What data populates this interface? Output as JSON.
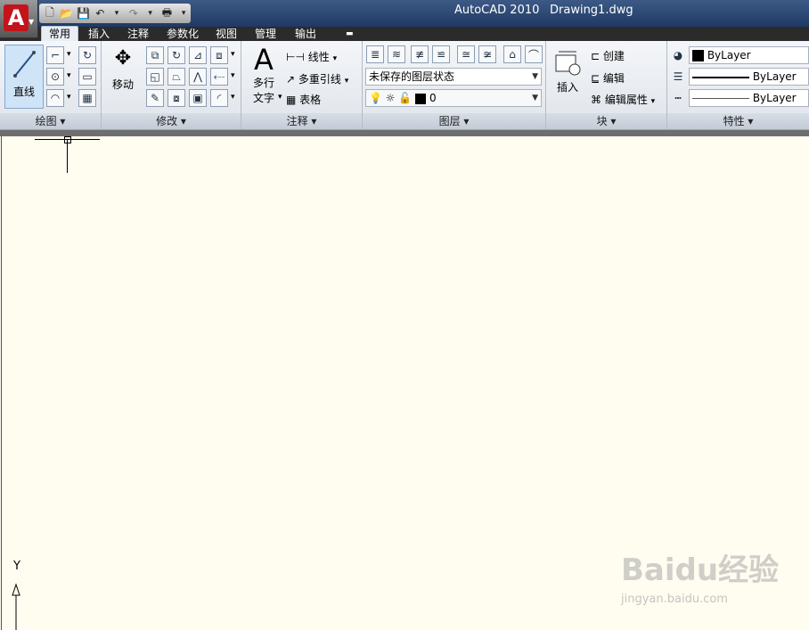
{
  "title": {
    "app": "AutoCAD 2010",
    "file": "Drawing1.dwg"
  },
  "app_button": {
    "letter": "A"
  },
  "qat": {
    "icons": [
      "new-icon",
      "open-icon",
      "save-icon",
      "undo-icon",
      "redo-icon",
      "plot-icon",
      "customize-icon"
    ]
  },
  "tabs": [
    "常用",
    "插入",
    "注释",
    "参数化",
    "视图",
    "管理",
    "输出"
  ],
  "ribbon": {
    "draw": {
      "title": "绘图 ▾",
      "line": "直线"
    },
    "modify": {
      "title": "修改 ▾",
      "move": "移动"
    },
    "annotate": {
      "title": "注释 ▾",
      "mtext_line1": "多行",
      "mtext_line2": "文字",
      "linear": "线性",
      "mleader": "多重引线",
      "table": "表格"
    },
    "layers": {
      "title": "图层 ▾",
      "state": "未保存的图层状态",
      "layer": "0"
    },
    "block": {
      "title": "块 ▾",
      "insert": "插入",
      "create": "创建",
      "edit": "编辑",
      "edit_attr": "编辑属性"
    },
    "properties": {
      "title": "特性 ▾",
      "color": "ByLayer",
      "linetype": "ByLayer",
      "lineweight": "ByLayer"
    }
  },
  "canvas": {
    "y_axis": "Y"
  },
  "watermark": {
    "brand": "Baidu经验",
    "url": "jingyan.baidu.com"
  },
  "colors": {
    "title_bar": "#2a4774",
    "canvas": "#fffcf0",
    "accent": "#c4131b"
  }
}
